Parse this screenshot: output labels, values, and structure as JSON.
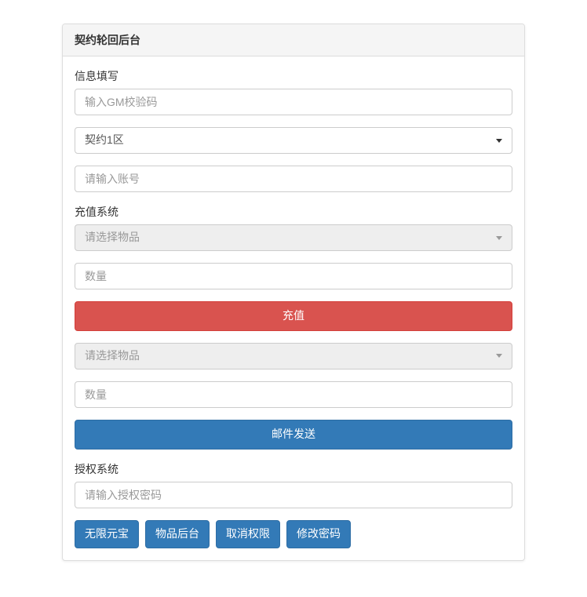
{
  "panel": {
    "title": "契约轮回后台"
  },
  "section1": {
    "label": "信息填写",
    "gm_code_placeholder": "输入GM校验码",
    "server_select": "契约1区",
    "account_placeholder": "请输入账号"
  },
  "section2": {
    "label": "充值系统",
    "item_select_placeholder": "请选择物品",
    "quantity_placeholder": "数量",
    "recharge_button": "充值",
    "item_select_placeholder2": "请选择物品",
    "quantity_placeholder2": "数量",
    "mail_send_button": "邮件发送"
  },
  "section3": {
    "label": "授权系统",
    "auth_password_placeholder": "请输入授权密码"
  },
  "buttons": {
    "unlimited_gold": "无限元宝",
    "item_backend": "物品后台",
    "cancel_permission": "取消权限",
    "change_password": "修改密码"
  }
}
